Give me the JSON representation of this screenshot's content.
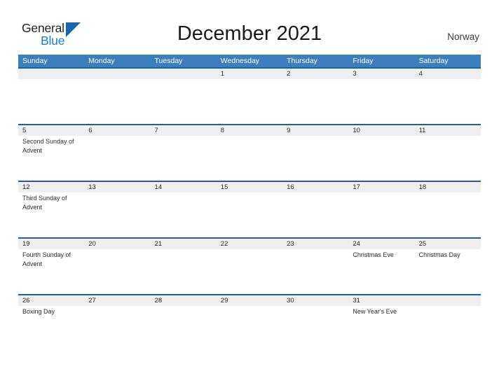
{
  "brand": {
    "name_part1": "General",
    "name_part2": "Blue",
    "triangle_color": "#1668b0",
    "blue_color": "#1a7fd4"
  },
  "header": {
    "title": "December 2021",
    "country": "Norway"
  },
  "theme": {
    "header_blue": "#3d7ebe",
    "row_divider_blue": "#1f5fa0",
    "number_band_gray": "#efefef"
  },
  "calendar": {
    "weekdays": [
      "Sunday",
      "Monday",
      "Tuesday",
      "Wednesday",
      "Thursday",
      "Friday",
      "Saturday"
    ],
    "weeks": [
      {
        "days": [
          {
            "num": "",
            "event": ""
          },
          {
            "num": "",
            "event": ""
          },
          {
            "num": "",
            "event": ""
          },
          {
            "num": "1",
            "event": ""
          },
          {
            "num": "2",
            "event": ""
          },
          {
            "num": "3",
            "event": ""
          },
          {
            "num": "4",
            "event": ""
          }
        ]
      },
      {
        "days": [
          {
            "num": "5",
            "event": "Second Sunday of Advent"
          },
          {
            "num": "6",
            "event": ""
          },
          {
            "num": "7",
            "event": ""
          },
          {
            "num": "8",
            "event": ""
          },
          {
            "num": "9",
            "event": ""
          },
          {
            "num": "10",
            "event": ""
          },
          {
            "num": "11",
            "event": ""
          }
        ]
      },
      {
        "days": [
          {
            "num": "12",
            "event": "Third Sunday of Advent"
          },
          {
            "num": "13",
            "event": ""
          },
          {
            "num": "14",
            "event": ""
          },
          {
            "num": "15",
            "event": ""
          },
          {
            "num": "16",
            "event": ""
          },
          {
            "num": "17",
            "event": ""
          },
          {
            "num": "18",
            "event": ""
          }
        ]
      },
      {
        "days": [
          {
            "num": "19",
            "event": "Fourth Sunday of Advent"
          },
          {
            "num": "20",
            "event": ""
          },
          {
            "num": "21",
            "event": ""
          },
          {
            "num": "22",
            "event": ""
          },
          {
            "num": "23",
            "event": ""
          },
          {
            "num": "24",
            "event": "Christmas Eve"
          },
          {
            "num": "25",
            "event": "Christmas Day"
          }
        ]
      },
      {
        "days": [
          {
            "num": "26",
            "event": "Boxing Day"
          },
          {
            "num": "27",
            "event": ""
          },
          {
            "num": "28",
            "event": ""
          },
          {
            "num": "29",
            "event": ""
          },
          {
            "num": "30",
            "event": ""
          },
          {
            "num": "31",
            "event": "New Year's Eve"
          },
          {
            "num": "",
            "event": ""
          }
        ]
      }
    ]
  }
}
